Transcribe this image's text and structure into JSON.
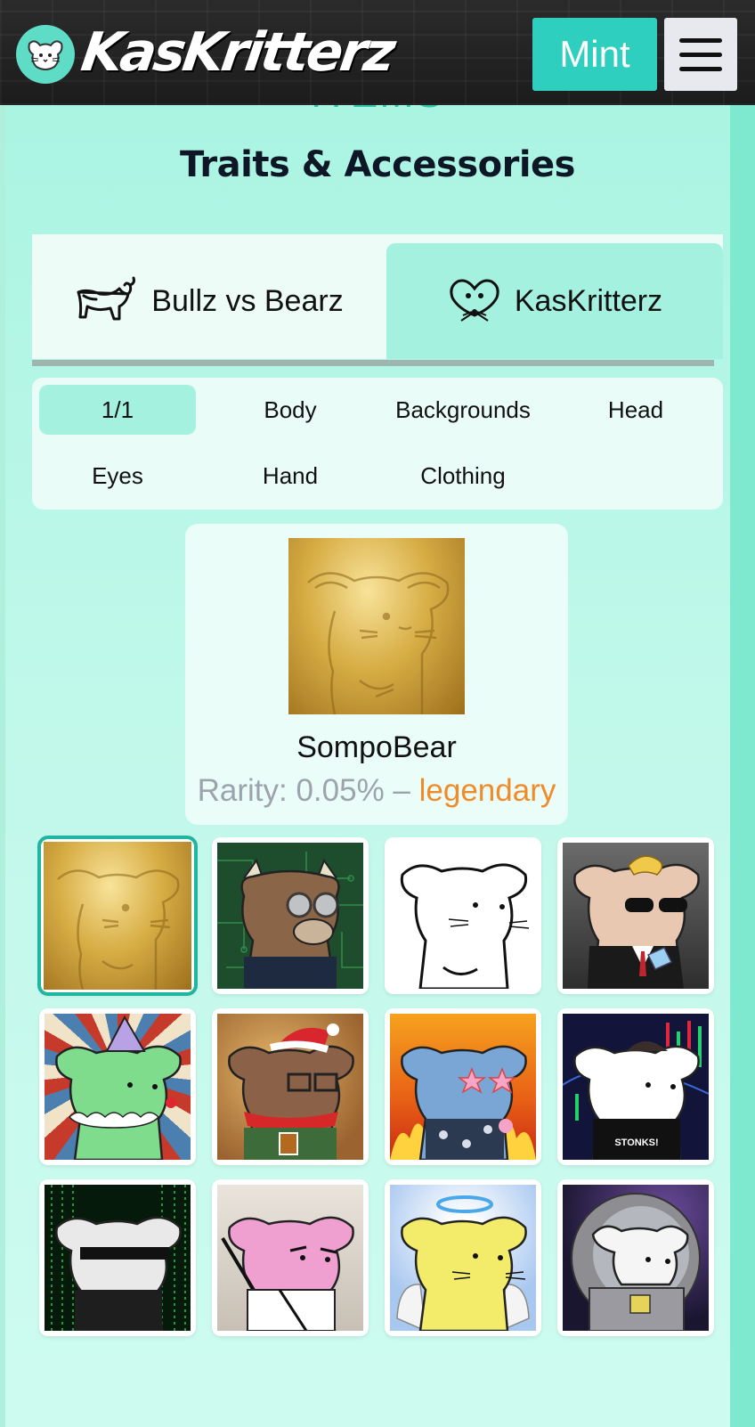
{
  "header": {
    "logo_text": "KasKritterz",
    "mint_label": "Mint"
  },
  "section": {
    "eyebrow": "ITEMS",
    "title": "Traits & Accessories"
  },
  "collections": [
    {
      "label": "Bullz vs Bearz",
      "icon": "bull-icon",
      "active": false
    },
    {
      "label": "KasKritterz",
      "icon": "mouse-heart-icon",
      "active": true
    }
  ],
  "categories": [
    {
      "label": "1/1",
      "active": true
    },
    {
      "label": "Body",
      "active": false
    },
    {
      "label": "Backgrounds",
      "active": false
    },
    {
      "label": "Head",
      "active": false
    },
    {
      "label": "Eyes",
      "active": false
    },
    {
      "label": "Hand",
      "active": false
    },
    {
      "label": "Clothing",
      "active": false
    }
  ],
  "featured": {
    "name": "SompoBear",
    "rarity_prefix": "Rarity: 0.05% – ",
    "rarity_tier": "legendary"
  },
  "grid": [
    {
      "name": "golden-critter",
      "selected": true
    },
    {
      "name": "circuit-bull-critter",
      "selected": false
    },
    {
      "name": "plain-white-critter",
      "selected": false
    },
    {
      "name": "suit-sunglasses-critter",
      "selected": false
    },
    {
      "name": "clown-critter",
      "selected": false
    },
    {
      "name": "santa-hat-critter",
      "selected": false
    },
    {
      "name": "flame-star-glasses-critter",
      "selected": false
    },
    {
      "name": "stonks-critter",
      "selected": false
    },
    {
      "name": "matrix-critter",
      "selected": false
    },
    {
      "name": "samurai-critter",
      "selected": false
    },
    {
      "name": "angel-critter",
      "selected": false
    },
    {
      "name": "astronaut-critter",
      "selected": false
    }
  ],
  "grid_label_text": "STONKS!",
  "colors": {
    "accent": "#2ecfbf",
    "tab_active": "#a4f1e0",
    "legendary": "#f08b2a",
    "heading": "#0e1726"
  }
}
